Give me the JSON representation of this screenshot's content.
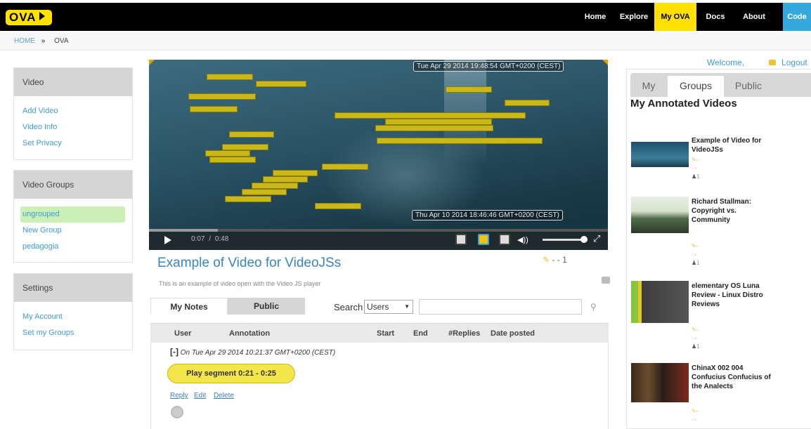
{
  "nav": {
    "logo": "OVA",
    "items": [
      {
        "label": "Home"
      },
      {
        "label": "Explore"
      },
      {
        "label": "My OVA"
      },
      {
        "label": "Docs"
      },
      {
        "label": "About"
      },
      {
        "label": "Code"
      }
    ],
    "active": "My OVA",
    "colors": {
      "accent": "#ffe100",
      "code": "#35a9dc"
    }
  },
  "breadcrumb": {
    "home": "HOME",
    "separator": "»",
    "current": "OVA"
  },
  "sidebar": {
    "video": {
      "title": "Video",
      "links": [
        "Add Video",
        "Video Info",
        "Set Privacy"
      ]
    },
    "groups": {
      "title": "Video Groups",
      "links": [
        "ungrouped",
        "New Group",
        "pedagogia"
      ],
      "selected": "ungrouped"
    },
    "settings": {
      "title": "Settings",
      "links": [
        "My Account",
        "Set my Groups"
      ]
    }
  },
  "player": {
    "timestamp_top": "Tue Apr 29 2014 19:48:54 GMT+0200 (CEST)",
    "timestamp_bottom": "Thu Apr 10 2014 18:46:46 GMT+0200 (CEST)",
    "time_current": "0:07",
    "time_sep": "/",
    "time_total": "0:48",
    "progress": 0.15
  },
  "video": {
    "title": "Example of Video for VideoJSs",
    "description": "This is an example of video open with the Video JS player",
    "stats": "- - 1"
  },
  "notes": {
    "tabs": [
      "My Notes",
      "Public"
    ],
    "search_label": "Search",
    "search_select": "Users",
    "columns": [
      "User",
      "Annotation",
      "Start",
      "End",
      "#Replies",
      "Date posted"
    ],
    "entry": {
      "toggle": "[-]",
      "date": "On Tue Apr 29 2014 10:21:37 GMT+0200 (CEST)",
      "segment_button": "Play segment 0:21 - 0:25",
      "actions": [
        "Reply",
        "Edit",
        "Delete"
      ]
    }
  },
  "right": {
    "welcome": "Welcome,",
    "logout": "Logout",
    "tabs": [
      "My",
      "Groups",
      "Public"
    ],
    "active_tab": "Groups",
    "title": "My Annotated Videos",
    "videos": [
      {
        "title": "Example of Video for VideoJSs",
        "stat1": "-",
        "stat2": "-",
        "stat3": "1"
      },
      {
        "title": "Richard Stallman: Copyright vs. Community",
        "stat1": "-",
        "stat2": "-",
        "stat3": "1"
      },
      {
        "title": "elementary OS Luna Review - Linux Distro Reviews",
        "stat1": "-",
        "stat2": "-",
        "stat3": "1"
      },
      {
        "title": "ChinaX 002 004 Confucius Confucius of the Analects",
        "stat1": "-",
        "stat2": "-",
        "stat3": ""
      }
    ]
  }
}
